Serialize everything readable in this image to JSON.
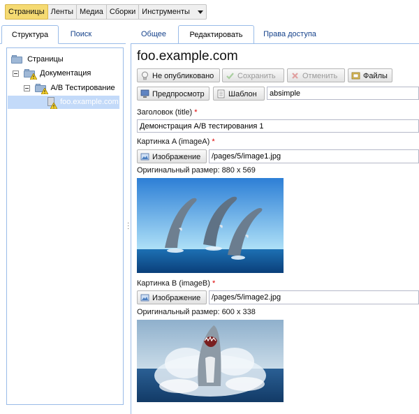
{
  "topnav": {
    "items": [
      "Страницы",
      "Ленты",
      "Медиа",
      "Сборки",
      "Инструменты"
    ]
  },
  "left_tabs": [
    "Структура",
    "Поиск"
  ],
  "right_tabs": [
    "Общее",
    "Редактировать",
    "Права доступа"
  ],
  "tree": {
    "items": [
      "Страницы",
      "Документация",
      "A/B Тестирование",
      "foo.example.com"
    ]
  },
  "editor": {
    "title": "foo.example.com",
    "toolbar": {
      "unpublished": "Не опубликовано",
      "save": "Сохранить",
      "cancel": "Отменить",
      "files": "Файлы",
      "preview": "Предпросмотр",
      "template": "Шаблон",
      "template_value": "absimple"
    },
    "fields": {
      "title_label": "Заголовок (title)",
      "title_value": "Демонстрация A/B тестирования 1",
      "imageA_label": "Картинка A (imageA)",
      "imageA_button": "Изображение",
      "imageA_path": "/pages/5/image1.jpg",
      "imageA_size": "Оригинальный размер: 880 x 569",
      "imageB_label": "Картинка B (imageB)",
      "imageB_button": "Изображение",
      "imageB_path": "/pages/5/image2.jpg",
      "imageB_size": "Оригинальный размер: 600 x 338",
      "required_mark": "*"
    }
  },
  "colors": {
    "active_nav": "#f5da72",
    "panel_border": "#99bbe8",
    "tab_text": "#15428b",
    "selected_row": "#c3daf9",
    "required": "#dd0000"
  },
  "icons": [
    "folder-icon",
    "warning-icon",
    "page-icon",
    "bulb-icon",
    "check-icon",
    "cancel-icon",
    "files-icon",
    "monitor-icon",
    "template-icon",
    "image-icon",
    "collapse-icon",
    "dropdown-arrow-icon"
  ]
}
